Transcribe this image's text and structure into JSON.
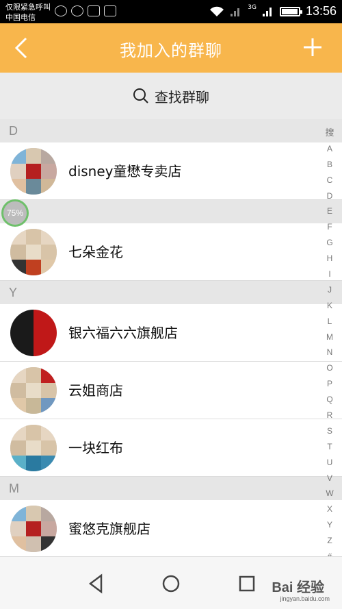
{
  "status_bar": {
    "carrier_line1": "仅限紧急呼叫",
    "carrier_line2": "中国电信",
    "network": "3G",
    "time": "13:56",
    "battery_level": 0.88
  },
  "header": {
    "title": "我加入的群聊",
    "back_icon": "chevron-left-icon",
    "add_icon": "plus-icon"
  },
  "search": {
    "label": "查找群聊",
    "icon": "search-icon"
  },
  "sections": [
    {
      "letter": "D",
      "groups": [
        "disney童懋专卖店"
      ]
    },
    {
      "letter": "",
      "groups": [
        "七朵金花"
      ]
    },
    {
      "letter": "Y",
      "groups": [
        "银六福六六旗舰店",
        "云姐商店",
        "一块红布"
      ]
    },
    {
      "letter": "M",
      "groups": [
        "蜜悠克旗舰店"
      ]
    }
  ],
  "index_letters": [
    "搜",
    "A",
    "B",
    "C",
    "D",
    "E",
    "F",
    "G",
    "H",
    "I",
    "J",
    "K",
    "L",
    "M",
    "N",
    "O",
    "P",
    "Q",
    "R",
    "S",
    "T",
    "U",
    "V",
    "W",
    "X",
    "Y",
    "Z",
    "#"
  ],
  "floating_badge": "75%",
  "watermark": {
    "brand": "Bai 经验",
    "url": "jingyan.baidu.com"
  },
  "colors": {
    "header_bg": "#f8b64c",
    "section_bg": "#e6e6e6",
    "badge_ring": "#6fc06b"
  }
}
